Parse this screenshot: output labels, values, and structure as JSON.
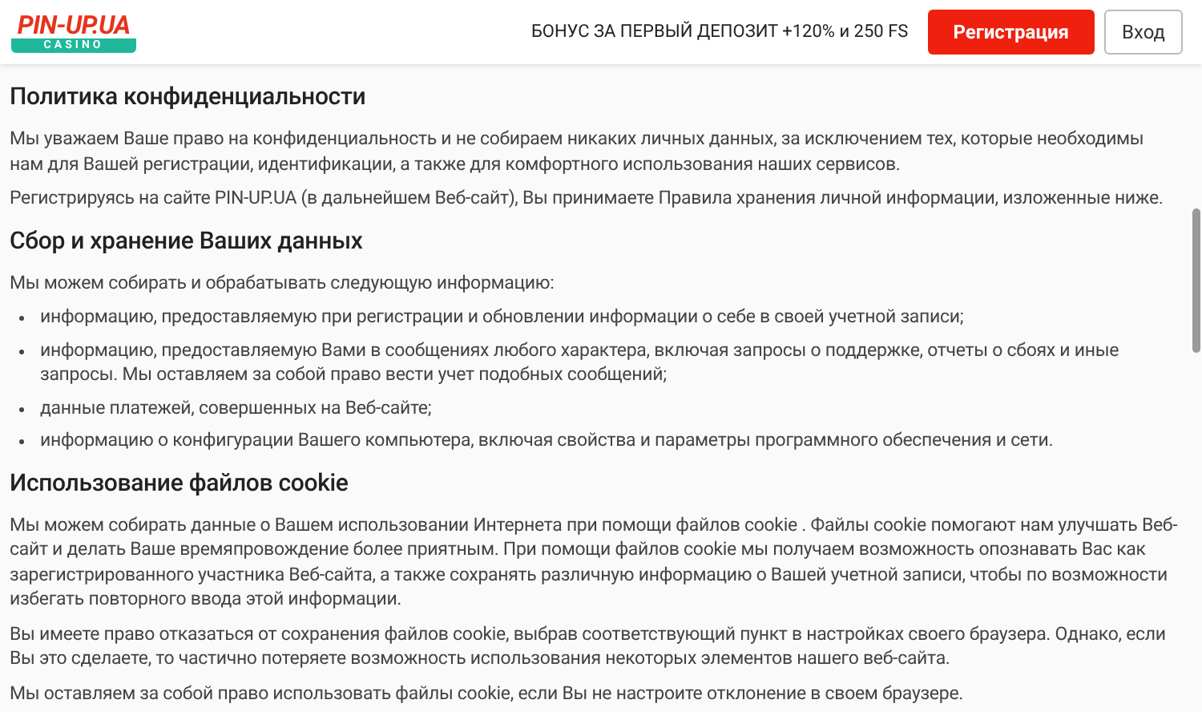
{
  "header": {
    "logo": {
      "name": "PIN-UP.UA",
      "badge": "CASINO"
    },
    "promo": "БОНУС ЗА ПЕРВЫЙ ДЕПОЗИТ +120% и 250 FS",
    "buttons": [
      {
        "kind": "primary",
        "label": "Регистрация"
      },
      {
        "kind": "secondary",
        "label": "Вход"
      }
    ]
  },
  "sections": [
    {
      "heading": "Политика конфиденциальности",
      "blocks": [
        {
          "kind": "paragraph",
          "text": "Мы уважаем Ваше право на конфиденциальность и не собираем никаких личных данных, за исключением тех, которые необходимы нам для Вашей регистрации, идентификации, а также для комфортного использования наших сервисов."
        },
        {
          "kind": "paragraph",
          "text": "Регистрируясь на сайте PIN-UP.UA (в дальнейшем Веб-сайт), Вы принимаете Правила хранения личной информации, изложенные ниже."
        }
      ]
    },
    {
      "heading": "Сбор и хранение Ваших данных",
      "blocks": [
        {
          "kind": "paragraph",
          "text": "Мы можем собирать и обрабатывать следующую информацию:"
        },
        {
          "kind": "list",
          "items": [
            "информацию, предоставляемую при регистрации и обновлении информации о себе в своей учетной записи;",
            "информацию, предоставляемую Вами в сообщениях любого характера, включая запросы о поддержке, отчеты о сбоях и иные запросы. Мы оставляем за собой право вести учет подобных сообщений;",
            "данные платежей, совершенных на Веб-сайте;",
            "информацию о конфигурации Вашего компьютера, включая свойства и параметры программного обеспечения и сети."
          ]
        }
      ]
    },
    {
      "heading": "Использование файлов cookie",
      "blocks": [
        {
          "kind": "paragraph",
          "text": "Мы можем собирать данные о Вашем использовании Интернета при помощи файлов cookie . Файлы cookie помогают нам улучшать Веб-сайт и делать Ваше времяпровождение более приятным. При помощи файлов cookie мы получаем возможность опознавать Вас как зарегистрированного участника Веб-сайта, а также сохранять различную информацию о Вашей учетной записи, чтобы по возможности избегать повторного ввода этой информации."
        },
        {
          "kind": "paragraph",
          "text": "Вы имеете право отказаться от сохранения файлов cookie, выбрав соответствующий пункт в настройках своего браузера. Однако, если Вы это сделаете, то частично потеряете возможность использования некоторых элементов нашего веб-сайта."
        },
        {
          "kind": "paragraph",
          "text": "Мы оставляем за собой право использовать файлы cookie, если Вы не настроите отклонение в своем браузере."
        }
      ]
    }
  ]
}
